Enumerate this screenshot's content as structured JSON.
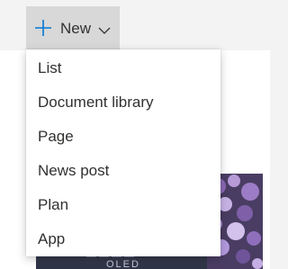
{
  "command_bar": {
    "new_label": "New",
    "icons": [
      "plus-icon",
      "chevron-down-icon"
    ]
  },
  "menu": {
    "items": [
      {
        "label": "List"
      },
      {
        "label": "Document library"
      },
      {
        "label": "Page"
      },
      {
        "label": "News post"
      },
      {
        "label": "Plan"
      },
      {
        "label": "App"
      }
    ]
  },
  "hero": {
    "text": "OLED"
  },
  "colors": {
    "accent": "#0078d4",
    "button_bg": "#d8d8d8",
    "text": "#323130"
  }
}
